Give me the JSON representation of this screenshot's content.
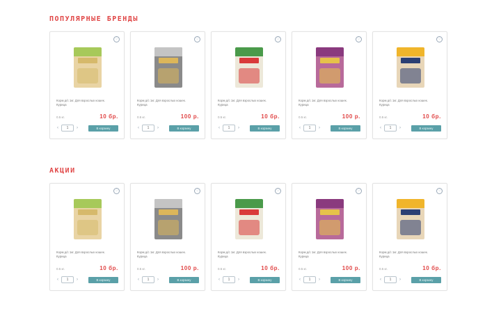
{
  "sections": [
    {
      "title": "ПОПУЛЯРНЫЕ БРЕНДЫ",
      "products": [
        {
          "description": "Корм д/с 1кг. Для взрослых кошек. Курица",
          "qty_label": "0.5 кг.",
          "price": "10 бр.",
          "quantity": "1",
          "cart_label": "В корзину",
          "colors": [
            "#a7c95a",
            "#d6b96b",
            "#e9d4a4"
          ]
        },
        {
          "description": "Корм д/с 1кг. Для взрослых кошек. Курица",
          "qty_label": "0.5 кг.",
          "price": "100 р.",
          "quantity": "1",
          "cart_label": "В корзину",
          "colors": [
            "#c4c4c4",
            "#dcb65a",
            "#8a8a8a"
          ]
        },
        {
          "description": "Корм д/с 1кг. Для взрослых кошек. Курица",
          "qty_label": "0.5 кг.",
          "price": "10 бр.",
          "quantity": "1",
          "cart_label": "В корзину",
          "colors": [
            "#4a9a4a",
            "#d93a3a",
            "#ede8d9"
          ]
        },
        {
          "description": "Корм д/с 1кг. Для взрослых кошек. Курица",
          "qty_label": "0.5 кг.",
          "price": "100 р.",
          "quantity": "1",
          "cart_label": "В корзину",
          "colors": [
            "#8a3a7e",
            "#e6c24a",
            "#b86a9a"
          ]
        },
        {
          "description": "Корм д/с 1кг. Для взрослых кошек. Курица",
          "qty_label": "0.5 кг.",
          "price": "10 бр.",
          "quantity": "1",
          "cart_label": "В корзину",
          "colors": [
            "#f0b52b",
            "#2b3f73",
            "#e8d6b8"
          ]
        }
      ]
    },
    {
      "title": "АКЦИИ",
      "products": [
        {
          "description": "Корм д/с 1кг. Для взрослых кошек. Курица",
          "qty_label": "0.5 кг.",
          "price": "10 бр.",
          "quantity": "1",
          "cart_label": "В корзину",
          "colors": [
            "#a7c95a",
            "#d6b96b",
            "#e9d4a4"
          ]
        },
        {
          "description": "Корм д/с 1кг. Для взрослых кошек. Курица",
          "qty_label": "0.5 кг.",
          "price": "100 р.",
          "quantity": "1",
          "cart_label": "В корзину",
          "colors": [
            "#c4c4c4",
            "#dcb65a",
            "#8a8a8a"
          ]
        },
        {
          "description": "Корм д/с 1кг. Для взрослых кошек. Курица",
          "qty_label": "0.5 кг.",
          "price": "10 бр.",
          "quantity": "1",
          "cart_label": "В корзину",
          "colors": [
            "#4a9a4a",
            "#d93a3a",
            "#ede8d9"
          ]
        },
        {
          "description": "Корм д/с 1кг. Для взрослых кошек. Курица",
          "qty_label": "0.5 кг.",
          "price": "100 р.",
          "quantity": "1",
          "cart_label": "В корзину",
          "colors": [
            "#8a3a7e",
            "#e6c24a",
            "#b86a9a"
          ]
        },
        {
          "description": "Корм д/с 1кг. Для взрослых кошек. Курица",
          "qty_label": "0.5 кг.",
          "price": "10 бр.",
          "quantity": "1",
          "cart_label": "В корзину",
          "colors": [
            "#f0b52b",
            "#2b3f73",
            "#e8d6b8"
          ]
        }
      ]
    }
  ],
  "accent_color": "#e04545",
  "button_color": "#5aa0a8",
  "icons": {
    "favorite": "heart-icon",
    "decrease": "chevron-left-icon",
    "increase": "chevron-right-icon"
  }
}
